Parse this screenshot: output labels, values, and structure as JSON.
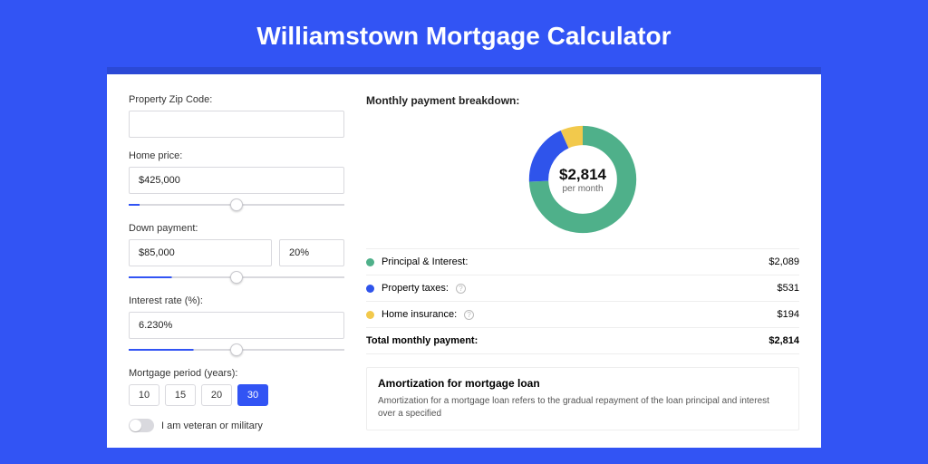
{
  "title": "Williamstown Mortgage Calculator",
  "form": {
    "zip": {
      "label": "Property Zip Code:",
      "value": ""
    },
    "homePrice": {
      "label": "Home price:",
      "value": "$425,000",
      "sliderFill": "5%"
    },
    "downPayment": {
      "label": "Down payment:",
      "amount": "$85,000",
      "percent": "20%",
      "sliderFill": "20%"
    },
    "interest": {
      "label": "Interest rate (%):",
      "value": "6.230%",
      "sliderFill": "30%"
    },
    "period": {
      "label": "Mortgage period (years):",
      "options": [
        "10",
        "15",
        "20",
        "30"
      ],
      "active": "30"
    },
    "veteran": {
      "label": "I am veteran or military"
    }
  },
  "breakdown": {
    "title": "Monthly payment breakdown:",
    "center": {
      "value": "$2,814",
      "sub": "per month"
    },
    "rows": [
      {
        "label": "Principal & Interest:",
        "value": "$2,089",
        "color": "#4fb08a",
        "info": false
      },
      {
        "label": "Property taxes:",
        "value": "$531",
        "color": "#2f54eb",
        "info": true
      },
      {
        "label": "Home insurance:",
        "value": "$194",
        "color": "#f2c94c",
        "info": true
      }
    ],
    "total": {
      "label": "Total monthly payment:",
      "value": "$2,814"
    }
  },
  "chart_data": {
    "type": "pie",
    "title": "Monthly payment breakdown",
    "series": [
      {
        "name": "Principal & Interest",
        "value": 2089,
        "color": "#4fb08a"
      },
      {
        "name": "Property taxes",
        "value": 531,
        "color": "#2f54eb"
      },
      {
        "name": "Home insurance",
        "value": 194,
        "color": "#f2c94c"
      }
    ],
    "total": 2814,
    "center_label": "$2,814 per month"
  },
  "amort": {
    "title": "Amortization for mortgage loan",
    "text": "Amortization for a mortgage loan refers to the gradual repayment of the loan principal and interest over a specified"
  }
}
